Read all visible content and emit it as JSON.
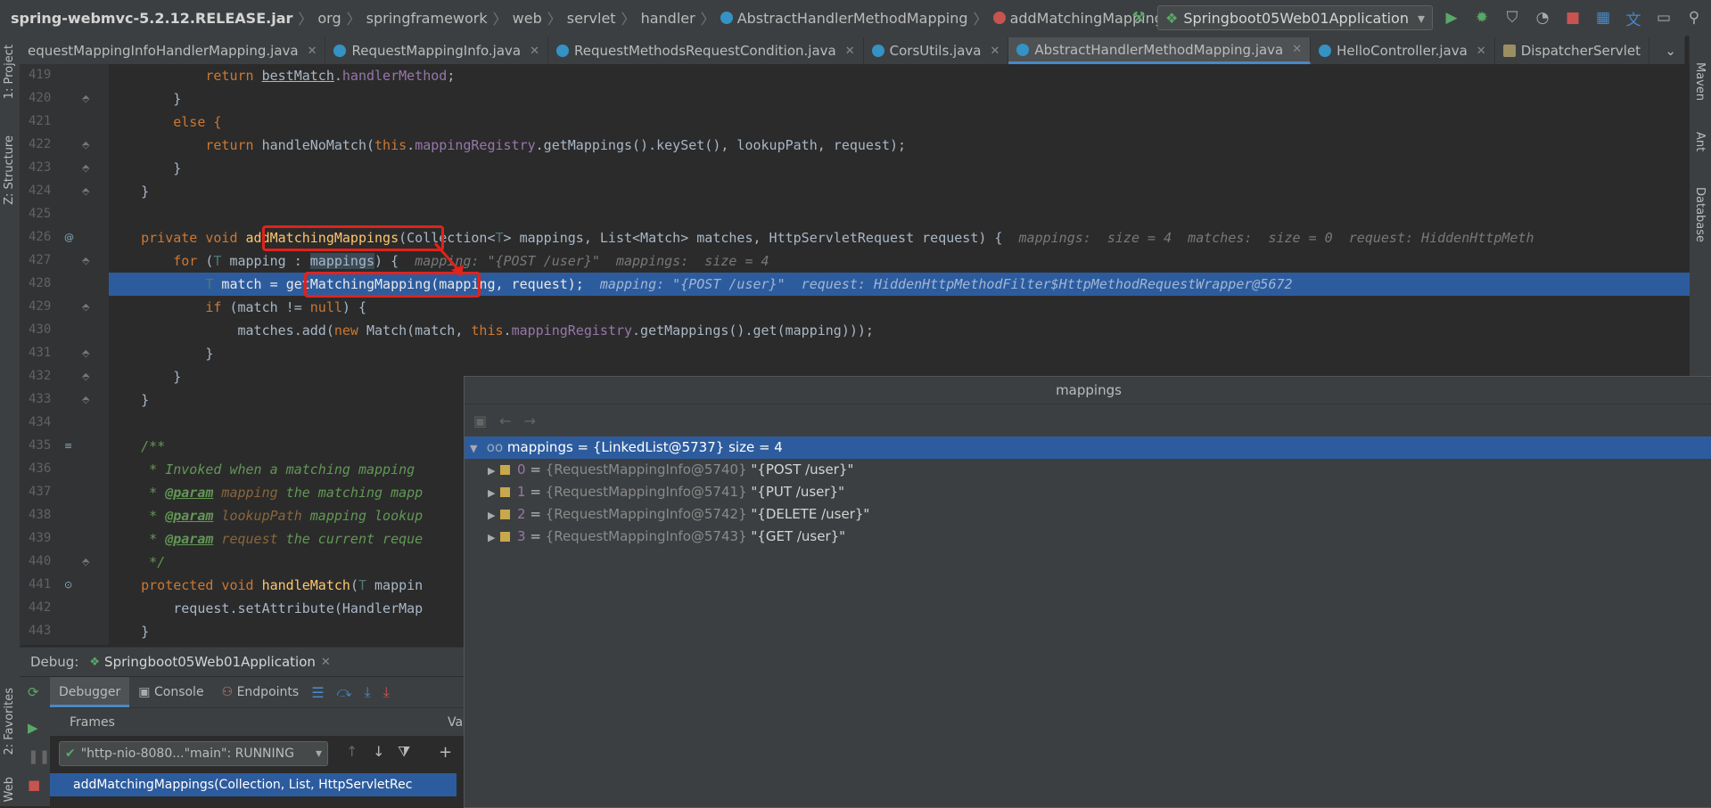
{
  "navbar": {
    "breadcrumbs": [
      "spring-webmvc-5.2.12.RELEASE.jar",
      "org",
      "springframework",
      "web",
      "servlet",
      "handler",
      "AbstractHandlerMethodMapping",
      "addMatchingMappings"
    ],
    "run_config": "Springboot05Web01Application"
  },
  "tabs": [
    {
      "label": "equestMappingInfoHandlerMapping.java",
      "active": false,
      "icon": "class-icon"
    },
    {
      "label": "RequestMappingInfo.java",
      "active": false,
      "icon": "class-icon"
    },
    {
      "label": "RequestMethodsRequestCondition.java",
      "active": false,
      "icon": "class-icon"
    },
    {
      "label": "CorsUtils.java",
      "active": false,
      "icon": "class-icon"
    },
    {
      "label": "AbstractHandlerMethodMapping.java",
      "active": true,
      "icon": "abstract-class-icon"
    },
    {
      "label": "HelloController.java",
      "active": false,
      "icon": "class-icon"
    },
    {
      "label": "DispatcherServlet",
      "active": false,
      "icon": "servlet-icon"
    }
  ],
  "side_tools": {
    "project": "1: Project",
    "structure": "Z: Structure",
    "favorites": "2: Favorites",
    "web": "Web",
    "maven": "Maven",
    "ant": "Ant",
    "database": "Database"
  },
  "line_numbers": [
    "419",
    "420",
    "421",
    "422",
    "423",
    "424",
    "425",
    "426",
    "427",
    "428",
    "429",
    "430",
    "431",
    "432",
    "433",
    "434",
    "435",
    "436",
    "437",
    "438",
    "439",
    "440",
    "441",
    "442",
    "443"
  ],
  "code": {
    "l419": {
      "kw": "return ",
      "a": "bestMatch",
      "dot": ".",
      "f": "handlerMethod",
      "end": ";"
    },
    "l420": "}",
    "l421": "else {",
    "l422": {
      "kw": "return ",
      "a": "handleNoMatch(",
      "th": "this",
      "dot": ".",
      "f": "mappingRegistry",
      "rest": ".getMappings().keySet(), lookupPath, request);"
    },
    "l423": "}",
    "l424": "}",
    "l426": {
      "kw": "private void ",
      "fn": "addMatchingMappings",
      "params": "(Collection<",
      "t": "T",
      "params2": "> mappings, List<Match> matches, HttpServletRequest request) {",
      "hint": "mappings:  size = 4  matches:  size = 0  request: HiddenHttpMeth"
    },
    "l427": {
      "kw": "for ",
      "a": "(",
      "t": "T",
      "b": " mapping : ",
      "c": "mappings",
      "d": ") {",
      "hint": "mapping: \"{POST /user}\"  mappings:  size = 4"
    },
    "l428": {
      "t": "T",
      "a": " match = ",
      "b": "getMatchingMapping",
      "c": "(mapping, request);",
      "hint": "mapping: \"{POST /user}\"  request: HiddenHttpMethodFilter$HttpMethodRequestWrapper@5672"
    },
    "l429": {
      "kw": "if ",
      "a": "(match != ",
      "kw2": "null",
      "b": ") {"
    },
    "l430": {
      "a": "matches.add(",
      "kw": "new ",
      "b": "Match(match, ",
      "th": "this",
      "dot": ".",
      "f": "mappingRegistry",
      "c": ".getMappings().get(mapping)));"
    },
    "l431": "}",
    "l432": "}",
    "l433": "}",
    "l435": "/**",
    "l436": " * Invoked when a matching mapping",
    "l437": {
      "a": " * ",
      "tag": "@param",
      "p": " mapping",
      "rest": " the matching mapp"
    },
    "l438": {
      "a": " * ",
      "tag": "@param",
      "p": " lookupPath",
      "rest": " mapping lookup"
    },
    "l439": {
      "a": " * ",
      "tag": "@param",
      "p": " request",
      "rest": " the current reque"
    },
    "l440": " */",
    "l441": {
      "kw": "protected void ",
      "fn": "handleMatch",
      "a": "(",
      "t": "T",
      "b": " mappin"
    },
    "l442": "request.setAttribute(HandlerMap",
    "l443": "}"
  },
  "popup": {
    "title": "mappings",
    "root": {
      "name": "mappings",
      "value": "{LinkedList@5737}",
      "size": "size = 4"
    },
    "children": [
      {
        "index": "0",
        "ref": "{RequestMappingInfo@5740}",
        "value": "\"{POST /user}\""
      },
      {
        "index": "1",
        "ref": "{RequestMappingInfo@5741}",
        "value": "\"{PUT /user}\""
      },
      {
        "index": "2",
        "ref": "{RequestMappingInfo@5742}",
        "value": "\"{DELETE /user}\""
      },
      {
        "index": "3",
        "ref": "{RequestMappingInfo@5743}",
        "value": "\"{GET /user}\""
      }
    ]
  },
  "debug": {
    "label": "Debug:",
    "config": "Springboot05Web01Application",
    "tabs": [
      "Debugger",
      "Console",
      "Endpoints"
    ],
    "frames_label": "Frames",
    "variables_label": "Va",
    "thread": "\"http-nio-8080...\"main\": RUNNING",
    "frame0": "addMatchingMappings(Collection, List, HttpServletRec"
  },
  "colors": {
    "accent": "#2d5c9e",
    "highlight_box": "#e0231b",
    "keyword": "#cc7832",
    "function": "#ffc66d",
    "field": "#9876aa"
  }
}
